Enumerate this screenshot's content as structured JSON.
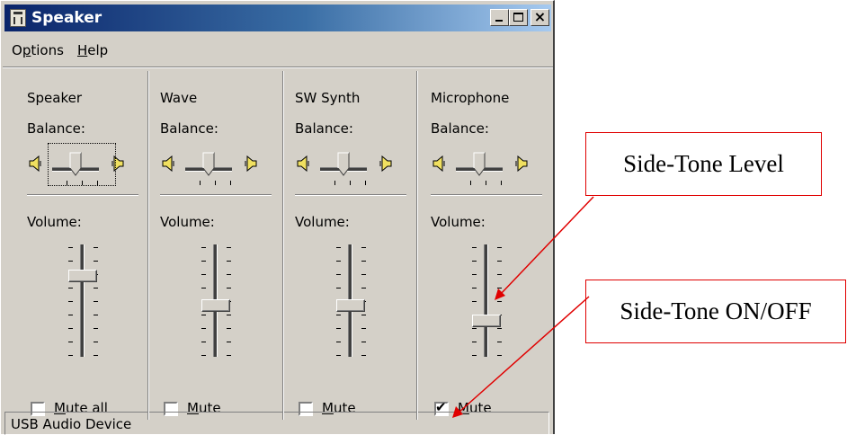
{
  "window": {
    "title": "Speaker",
    "menu": [
      "Options",
      "Help"
    ],
    "status": "USB Audio Device"
  },
  "channels": [
    {
      "name": "Speaker",
      "balance_label": "Balance:",
      "volume_label": "Volume:",
      "mute_label": "Mute all",
      "muted": false,
      "volume_level": 0.75,
      "focused": true
    },
    {
      "name": "Wave",
      "balance_label": "Balance:",
      "volume_label": "Volume:",
      "mute_label": "Mute",
      "muted": false,
      "volume_level": 0.45,
      "focused": false
    },
    {
      "name": "SW Synth",
      "balance_label": "Balance:",
      "volume_label": "Volume:",
      "mute_label": "Mute",
      "muted": false,
      "volume_level": 0.45,
      "focused": false
    },
    {
      "name": "Microphone",
      "balance_label": "Balance:",
      "volume_label": "Volume:",
      "mute_label": "Mute",
      "muted": true,
      "volume_level": 0.3,
      "focused": false
    }
  ],
  "callouts": {
    "level": "Side-Tone Level",
    "onoff": "Side-Tone ON/OFF",
    "color": "#e00000"
  },
  "colors": {
    "titlebar_start": "#0a246a",
    "titlebar_end": "#a6caf0",
    "face": "#d4d0c8"
  }
}
